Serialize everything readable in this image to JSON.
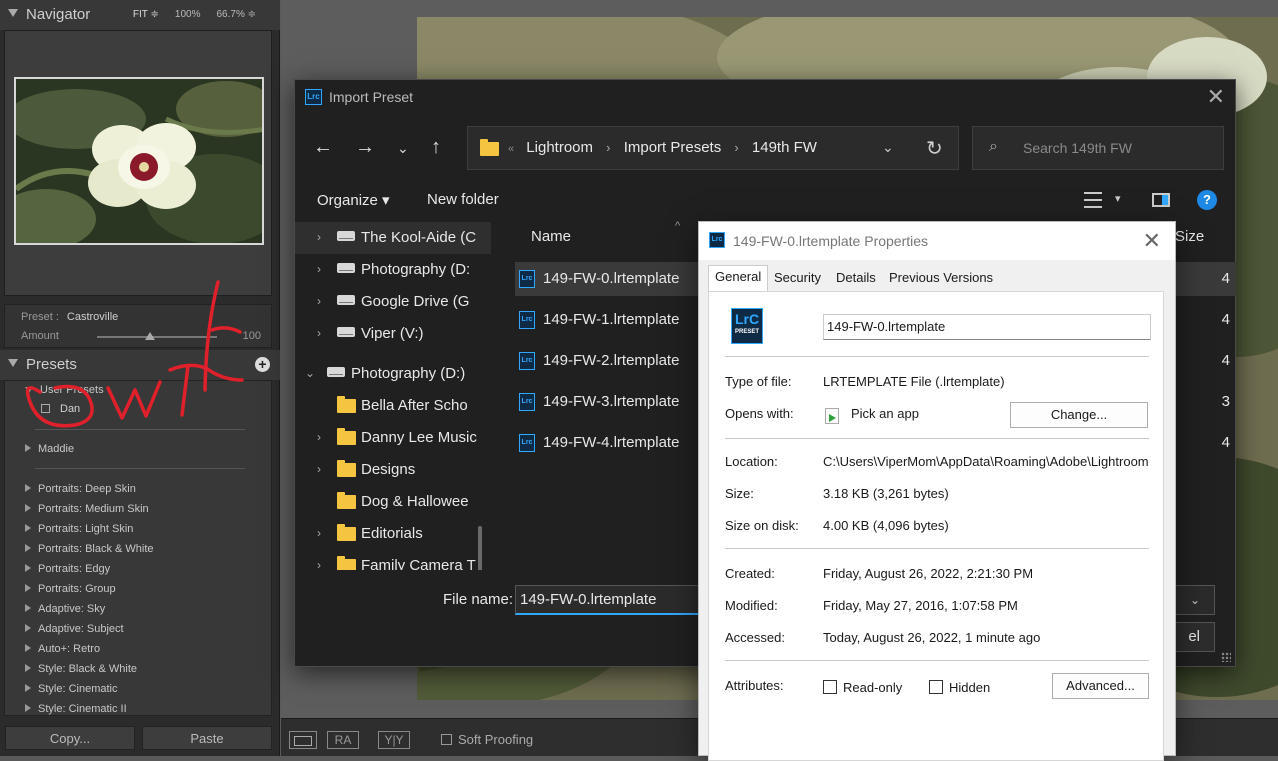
{
  "navigator": {
    "title": "Navigator",
    "fit": "FIT ≑",
    "zoom1": "100%",
    "zoom2": "66.7% ≑"
  },
  "preset_panel": {
    "preset_label": "Preset :",
    "preset_value": "Castroville",
    "amount_label": "Amount",
    "amount_value": "100"
  },
  "presets": {
    "title": "Presets",
    "user_presets": "User Presets",
    "dan": "Dan",
    "groups": [
      "Maddie",
      "Portraits: Deep Skin",
      "Portraits: Medium Skin",
      "Portraits: Light Skin",
      "Portraits: Black & White",
      "Portraits: Edgy",
      "Portraits: Group",
      "Adaptive: Sky",
      "Adaptive: Subject",
      "Auto+: Retro",
      "Style: Black & White",
      "Style: Cinematic",
      "Style: Cinematic II"
    ]
  },
  "lr_buttons": {
    "copy": "Copy...",
    "paste": "Paste"
  },
  "lr_toolbar": {
    "ra": "RA",
    "yy": "Y|Y",
    "soft_proofing": "Soft Proofing"
  },
  "import_dialog": {
    "title": "Import Preset",
    "app_icon": "Lrc",
    "crumbs": [
      "Lightroom",
      "Import Presets",
      "149th FW"
    ],
    "search_placeholder": "Search 149th FW",
    "organize": "Organize ▾",
    "new_folder": "New folder",
    "tree": [
      {
        "label": "The Kool-Aide (C",
        "icon": "drive-system-icon",
        "expand": "›"
      },
      {
        "label": "Photography (D:",
        "icon": "drive-icon",
        "expand": "›"
      },
      {
        "label": "Google Drive (G",
        "icon": "drive-icon",
        "expand": "›"
      },
      {
        "label": "Viper (V:)",
        "icon": "drive-icon",
        "expand": "›"
      },
      {
        "label": "Photography (D:)",
        "icon": "drive-icon",
        "expand": "⌄"
      },
      {
        "label": "Bella After Scho",
        "icon": "folder-icon",
        "expand": ""
      },
      {
        "label": "Danny Lee Music",
        "icon": "folder-icon",
        "expand": "›"
      },
      {
        "label": "Designs",
        "icon": "folder-icon",
        "expand": "›"
      },
      {
        "label": "Dog & Hallowee",
        "icon": "folder-icon",
        "expand": ""
      },
      {
        "label": "Editorials",
        "icon": "folder-icon",
        "expand": "›"
      },
      {
        "label": "Family Camera T",
        "icon": "folder-icon",
        "expand": "›"
      }
    ],
    "columns": {
      "name": "Name",
      "size": "Size"
    },
    "files": [
      {
        "name": "149-FW-0.lrtemplate",
        "size": "4"
      },
      {
        "name": "149-FW-1.lrtemplate",
        "size": "4"
      },
      {
        "name": "149-FW-2.lrtemplate",
        "size": "4"
      },
      {
        "name": "149-FW-3.lrtemplate",
        "size": "3"
      },
      {
        "name": "149-FW-4.lrtemplate",
        "size": "4"
      }
    ],
    "file_name_label": "File name:",
    "file_name_value": "149-FW-0.lrtemplate",
    "cancel_partial": "el"
  },
  "properties": {
    "title": "149-FW-0.lrtemplate Properties",
    "tabs": [
      "General",
      "Security",
      "Details",
      "Previous Versions"
    ],
    "icon_top": "LrC",
    "icon_bottom": "PRESET",
    "file_name": "149-FW-0.lrtemplate",
    "type_label": "Type of file:",
    "type_value": "LRTEMPLATE File (.lrtemplate)",
    "opens_label": "Opens with:",
    "opens_value": "Pick an app",
    "change_button": "Change...",
    "location_label": "Location:",
    "location_value": "C:\\Users\\ViperMom\\AppData\\Roaming\\Adobe\\Lightroom",
    "size_label": "Size:",
    "size_value": "3.18 KB (3,261 bytes)",
    "disk_label": "Size on disk:",
    "disk_value": "4.00 KB (4,096 bytes)",
    "created_label": "Created:",
    "created_value": "Friday, August 26, 2022, 2:21:30 PM",
    "modified_label": "Modified:",
    "modified_value": "Friday, May 27, 2016, 1:07:58 PM",
    "accessed_label": "Accessed:",
    "accessed_value": "Today, August 26, 2022, 1 minute ago",
    "attributes_label": "Attributes:",
    "readonly_label": "Read-only",
    "hidden_label": "Hidden",
    "advanced_button": "Advanced..."
  },
  "annotation": {
    "text": "WTF",
    "color": "#e0202a"
  }
}
